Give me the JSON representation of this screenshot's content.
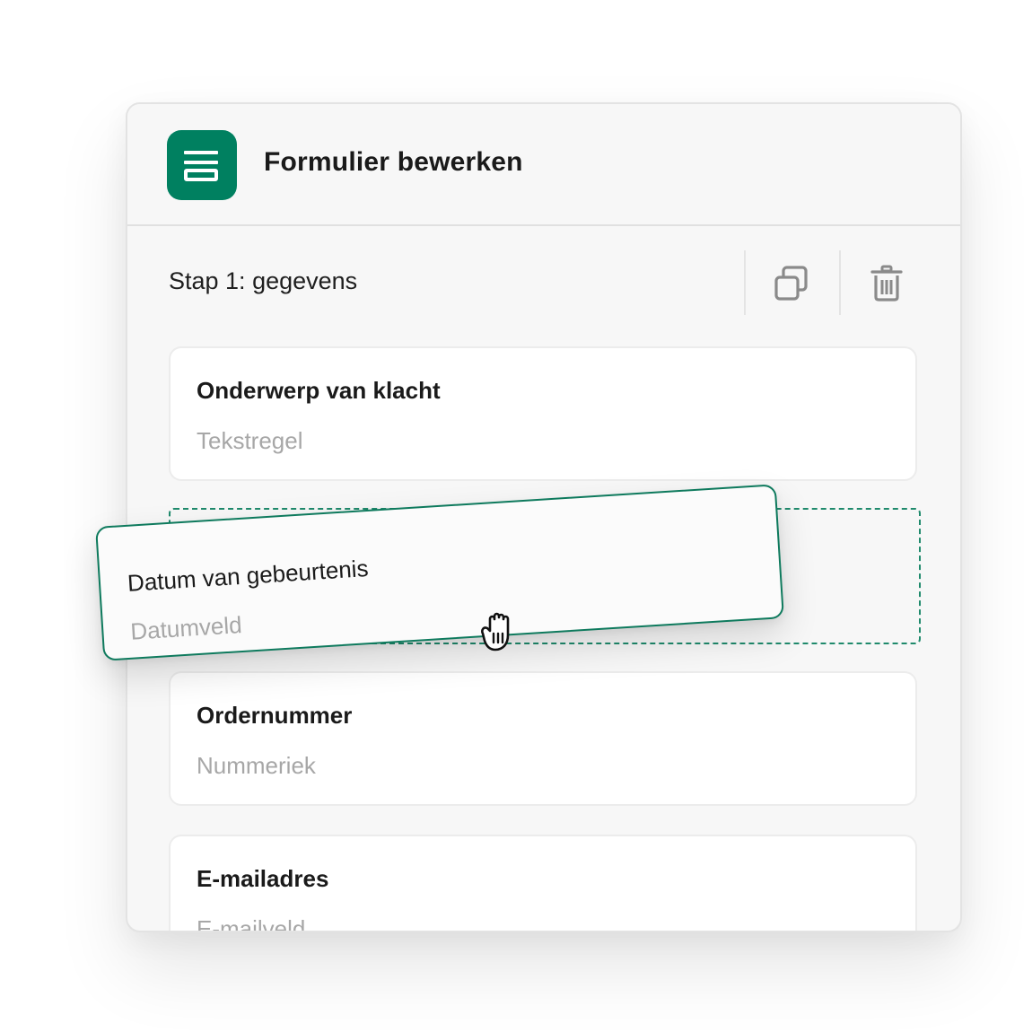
{
  "header": {
    "title": "Formulier bewerken",
    "icon": "form-list-icon",
    "accent_color": "#008060"
  },
  "step": {
    "title": "Stap 1: gegevens",
    "actions": [
      {
        "icon": "duplicate-icon"
      },
      {
        "icon": "trash-icon"
      }
    ]
  },
  "fields": [
    {
      "label": "Onderwerp van klacht",
      "type": "Tekstregel"
    },
    {
      "label": "Ordernummer",
      "type": "Nummeriek"
    },
    {
      "label": "E-mailadres",
      "type": "E-mailveld"
    }
  ],
  "dragging": {
    "label": "Datum van gebeurtenis",
    "type": "Datumveld",
    "cursor": "grab-hand-icon"
  }
}
